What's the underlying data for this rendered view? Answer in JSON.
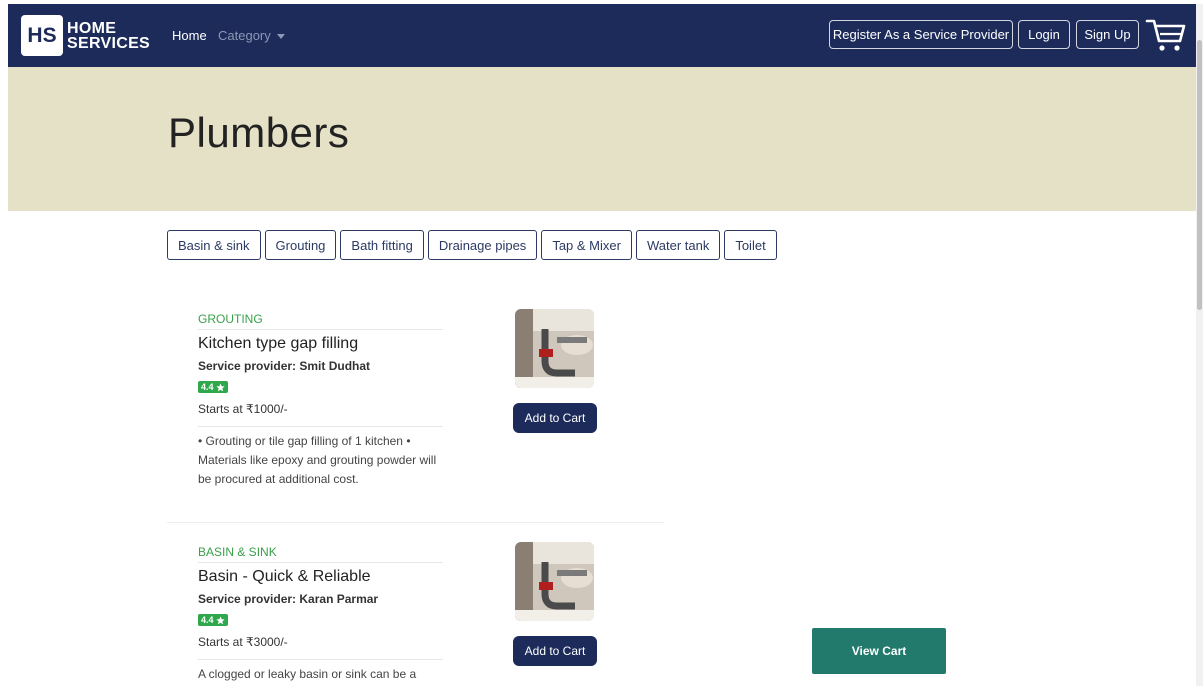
{
  "nav": {
    "logo_mark": "HS",
    "logo_line1": "HOME",
    "logo_line2": "SERVICES",
    "home": "Home",
    "category": "Category",
    "register": "Register As a Service Provider",
    "login": "Login",
    "signup": "Sign Up",
    "cart_icon": "cart-icon"
  },
  "hero": {
    "title": "Plumbers"
  },
  "tabs": [
    "Basin & sink",
    "Grouting",
    "Bath fitting",
    "Drainage pipes",
    "Tap & Mixer",
    "Water tank",
    "Toilet"
  ],
  "services": [
    {
      "category": "GROUTING",
      "title": "Kitchen type gap filling",
      "provider": "Service provider: Smit Dudhat",
      "rating": "4.4",
      "price": "Starts at ₹1000/-",
      "description": "• Grouting or tile gap filling of 1 kitchen • Materials like epoxy and grouting powder will be procured at additional cost.",
      "add_label": "Add to Cart"
    },
    {
      "category": "BASIN & SINK",
      "title": "Basin - Quick & Reliable",
      "provider": "Service provider: Karan Parmar",
      "rating": "4.4",
      "price": "Starts at ₹3000/-",
      "description": "A clogged or leaky basin or sink can be a",
      "add_label": "Add to Cart"
    }
  ],
  "view_cart": "View Cart",
  "colors": {
    "navbar": "#1c2b5a",
    "hero": "#e5e1c6",
    "category_green": "#3aa04b",
    "rating_green": "#2ea84a",
    "view_cart": "#217a6b"
  }
}
